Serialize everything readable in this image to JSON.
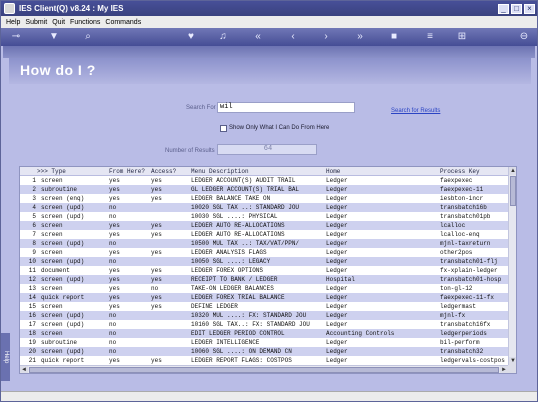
{
  "window": {
    "title": "IES Client(Q) v8.24 : My IES"
  },
  "menu": {
    "items": [
      "Help",
      "Submit",
      "Quit",
      "Functions",
      "Commands"
    ]
  },
  "toolbar": {
    "icons": [
      "key-icon",
      "filter-icon",
      "search-icon",
      "heart-icon",
      "bell-icon",
      "rewind-icon",
      "back-icon",
      "forward-icon",
      "fast-forward-icon",
      "stop-icon",
      "list-icon",
      "grid-icon",
      "zoom-out-icon"
    ]
  },
  "page": {
    "title": "How do I ?"
  },
  "form": {
    "search_label": "Search For",
    "search_value": "wil",
    "search_link": "Search for Results",
    "checkbox_label": "Show Only What I Can Do From Here",
    "results_label": "Number of Results",
    "results_value": "64"
  },
  "table": {
    "headers": [
      ">>> Type",
      "From Here?",
      "Access?",
      "Menu Description",
      "Home",
      "Process Key"
    ],
    "rows": [
      [
        "1",
        "screen",
        "yes",
        "yes",
        "LEDGER ACCOUNT(S) AUDIT TRAIL",
        "Ledger",
        "faexpexec"
      ],
      [
        "2",
        "subroutine",
        "yes",
        "yes",
        "GL LEDGER ACCOUNT(S) TRIAL BAL",
        "Ledger",
        "faexpexec-11"
      ],
      [
        "3",
        "screen (enq)",
        "yes",
        "yes",
        "LEDGER BALANCE TAKE ON",
        "Ledger",
        "iesbton-incr"
      ],
      [
        "4",
        "screen (upd)",
        "no",
        "",
        "10020 SGL TAX ..: STANDARD JOU",
        "Ledger",
        "transbatch16b"
      ],
      [
        "5",
        "screen (upd)",
        "no",
        "",
        "10030 SGL ....: PHYSICAL",
        "Ledger",
        "transbatch01pb"
      ],
      [
        "6",
        "screen",
        "yes",
        "yes",
        "LEDGER AUTO RE-ALLOCATIONS",
        "Ledger",
        "lcalloc"
      ],
      [
        "7",
        "screen",
        "yes",
        "yes",
        "LEDGER AUTO RE-ALLOCATIONS",
        "Ledger",
        "lcalloc-enq"
      ],
      [
        "8",
        "screen (upd)",
        "no",
        "",
        "10500 MUL TAX ..: TAX/VAT/PPN/",
        "Ledger",
        "mjnl-taxreturn"
      ],
      [
        "9",
        "screen",
        "yes",
        "yes",
        "LEDGER ANALYSIS FLAGS",
        "Ledger",
        "other2pos"
      ],
      [
        "10",
        "screen (upd)",
        "no",
        "",
        "10050 SGL ....: LEGACY",
        "Ledger",
        "transbatch01-flj"
      ],
      [
        "11",
        "document",
        "yes",
        "yes",
        "LEDGER FOREX OPTIONS",
        "Ledger",
        "fx-xplain-ledger"
      ],
      [
        "12",
        "screen (upd)",
        "yes",
        "yes",
        "RECEIPT TO BANK / LEDGER",
        "Hospital",
        "transbatch01-hosp"
      ],
      [
        "13",
        "screen",
        "yes",
        "no",
        "TAKE-ON LEDGER BALANCES",
        "Ledger",
        "ton-gl-12"
      ],
      [
        "14",
        "quick report",
        "yes",
        "yes",
        "LEDGER FOREX TRIAL BALANCE",
        "Ledger",
        "faexpexec-11-fx"
      ],
      [
        "15",
        "screen",
        "yes",
        "yes",
        "DEFINE LEDGER",
        "Ledger",
        "ledgermast"
      ],
      [
        "16",
        "screen (upd)",
        "no",
        "",
        "10320 MUL ....: FX: STANDARD JOU",
        "Ledger",
        "mjnl-fx"
      ],
      [
        "17",
        "screen (upd)",
        "no",
        "",
        "10160 SGL TAX..: FX: STANDARD JOU",
        "Ledger",
        "transbatch16fx"
      ],
      [
        "18",
        "screen",
        "no",
        "",
        "EDIT LEDGER PERIOD CONTROL",
        "Accounting Controls",
        "ledgerperiods"
      ],
      [
        "19",
        "subroutine",
        "no",
        "",
        "LEDGER INTELLIGENCE",
        "Ledger",
        "bil-perform"
      ],
      [
        "20",
        "screen (upd)",
        "no",
        "",
        "10060 SGL ....: ON DEMAND CN",
        "Ledger",
        "transbatch32"
      ],
      [
        "21",
        "quick report",
        "yes",
        "yes",
        "LEDGER REPORT FLAGS: COSTPOS",
        "Ledger",
        "ledgervals-costpos"
      ]
    ]
  },
  "colors": {
    "titlebar": "#3e4686",
    "background": "#b9bce6",
    "row_alt": "#ced1ef",
    "link": "#2b44c4"
  }
}
